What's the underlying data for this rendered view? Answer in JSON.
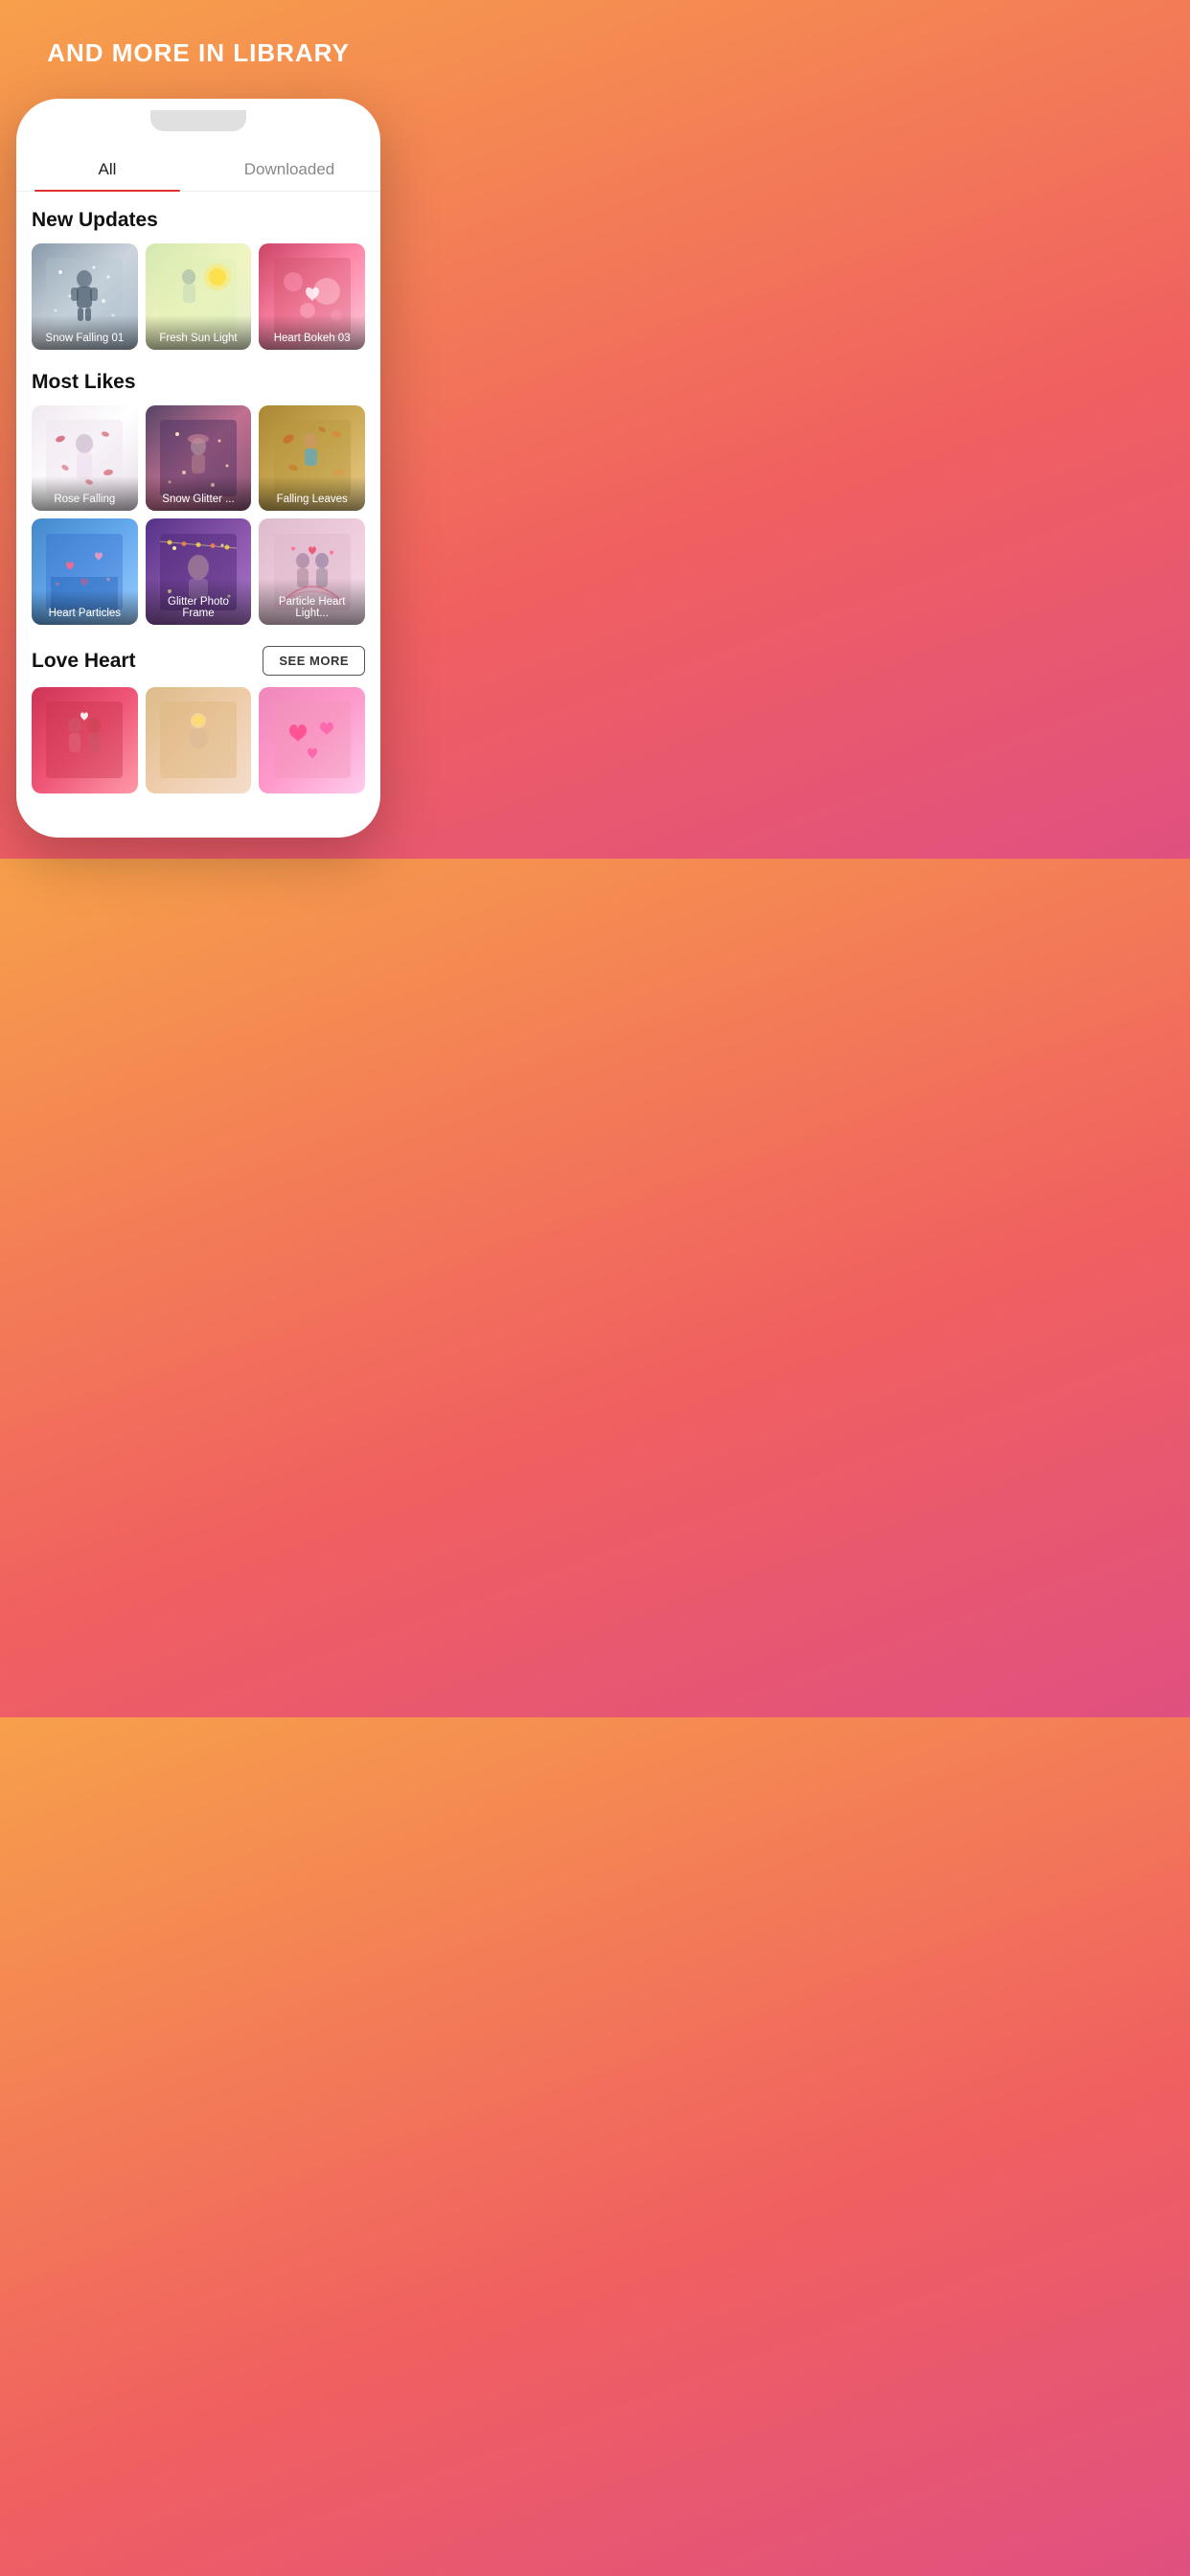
{
  "header": {
    "title": "AND MORE IN LIBRARY"
  },
  "tabs": [
    {
      "id": "all",
      "label": "All",
      "active": true
    },
    {
      "id": "downloaded",
      "label": "Downloaded",
      "active": false
    }
  ],
  "sections": {
    "new_updates": {
      "title": "New Updates",
      "items": [
        {
          "id": "snow-falling-01",
          "label": "Snow Falling 01",
          "bg": "bg-snow1"
        },
        {
          "id": "fresh-sun-light",
          "label": "Fresh Sun Light",
          "bg": "bg-sunlight"
        },
        {
          "id": "heart-bokeh-03",
          "label": "Heart Bokeh 03",
          "bg": "bg-heartbokeh"
        }
      ]
    },
    "most_likes": {
      "title": "Most Likes",
      "items": [
        {
          "id": "rose-falling",
          "label": "Rose Falling",
          "bg": "bg-rosefalling"
        },
        {
          "id": "snow-glitter",
          "label": "Snow Glitter ...",
          "bg": "bg-snowglitter"
        },
        {
          "id": "falling-leaves",
          "label": "Falling Leaves",
          "bg": "bg-fallingleaves"
        },
        {
          "id": "heart-particles",
          "label": "Heart Particles",
          "bg": "bg-heartparticles"
        },
        {
          "id": "glitter-photo-frame",
          "label": "Glitter Photo Frame",
          "bg": "bg-glitterframe"
        },
        {
          "id": "particle-heart-light",
          "label": "Particle Heart Light...",
          "bg": "bg-particleheart"
        }
      ]
    },
    "love_heart": {
      "title": "Love Heart",
      "see_more": "SEE MORE",
      "items": [
        {
          "id": "love-heart-1",
          "label": "",
          "bg": "bg-loveheart1"
        },
        {
          "id": "love-heart-2",
          "label": "",
          "bg": "bg-loveheart2"
        },
        {
          "id": "love-heart-3",
          "label": "",
          "bg": "bg-loveheart3"
        }
      ]
    }
  }
}
